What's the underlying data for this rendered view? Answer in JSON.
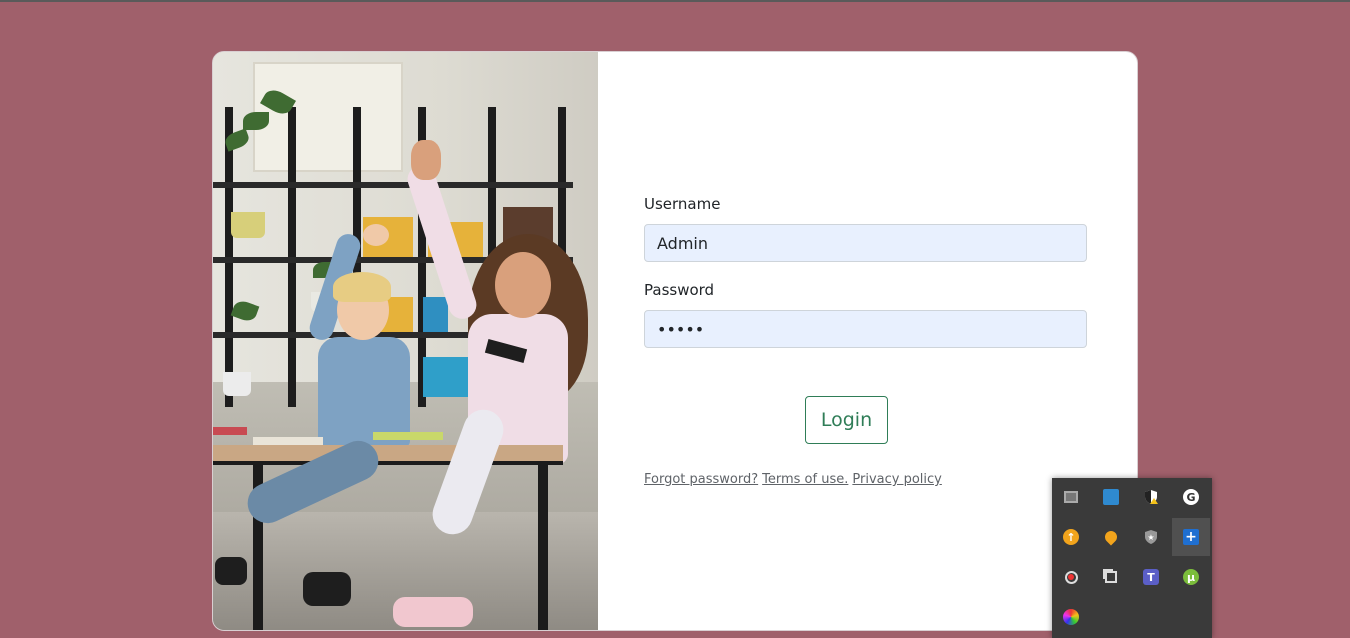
{
  "form": {
    "username_label": "Username",
    "username_value": "Admin",
    "password_label": "Password",
    "password_value": "•••••",
    "login_label": "Login",
    "links": [
      "Forgot password?",
      "Terms of use.",
      "Privacy policy"
    ]
  },
  "colors": {
    "page_background": "#a0606b",
    "card_background": "#ffffff",
    "input_background": "#e8f0fe",
    "button_accent": "#2f7d57",
    "tray_background": "#3a3a3a"
  },
  "image": {
    "description_icon": "classroom-photo"
  },
  "tray": {
    "icons": [
      "monitor-icon",
      "network-app-icon",
      "security-shield-icon",
      "grammarly-icon",
      "upload-icon",
      "drop-icon",
      "shield-star-icon",
      "plus-icon",
      "sync-icon",
      "copy-icon",
      "teams-icon",
      "torrent-icon",
      "color-wheel-icon"
    ]
  }
}
